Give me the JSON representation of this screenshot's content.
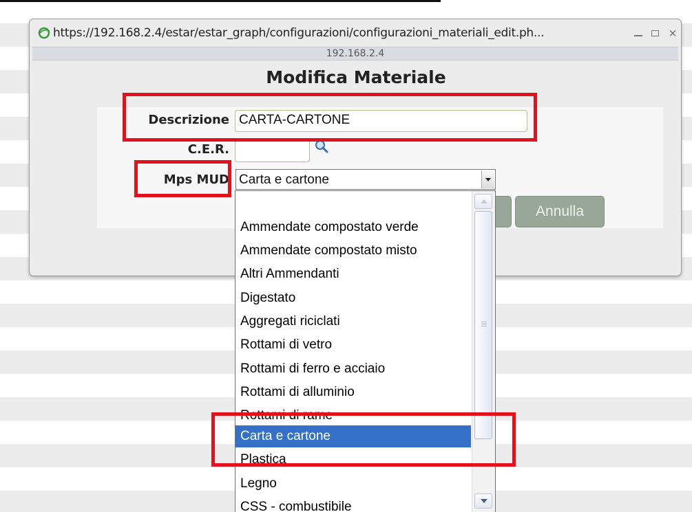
{
  "window": {
    "url": "https://192.168.2.4/estar/estar_graph/configurazioni/configurazioni_materiali_edit.ph...",
    "address": "192.168.2.4",
    "controls": {
      "minimize": "minimize-icon",
      "maximize": "maximize-icon",
      "close": "×"
    }
  },
  "form": {
    "title": "Modifica Materiale",
    "descrizione_label": "Descrizione",
    "descrizione_value": "CARTA-CARTONE",
    "cer_label": "C.E.R.",
    "cer_value": "",
    "mps_label": "Mps MUD",
    "mps_value": "Carta e cartone",
    "annulla_label": "Annulla"
  },
  "dropdown": {
    "options": [
      "",
      "Ammendate compostato verde",
      "Ammendate compostato misto",
      "Altri Ammendanti",
      "Digestato",
      "Aggregati riciclati",
      "Rottami di vetro",
      "Rottami di ferro e acciaio",
      "Rottami di alluminio",
      "Rottami di rame",
      "Carta e cartone",
      "Plastica",
      "Legno",
      "CSS - combustibile"
    ],
    "selected_index": 10
  },
  "colors": {
    "highlight": "#e2111c",
    "selected_bg": "#3470c8",
    "input_border": "#a6c889",
    "button_bg": "#98a798"
  }
}
